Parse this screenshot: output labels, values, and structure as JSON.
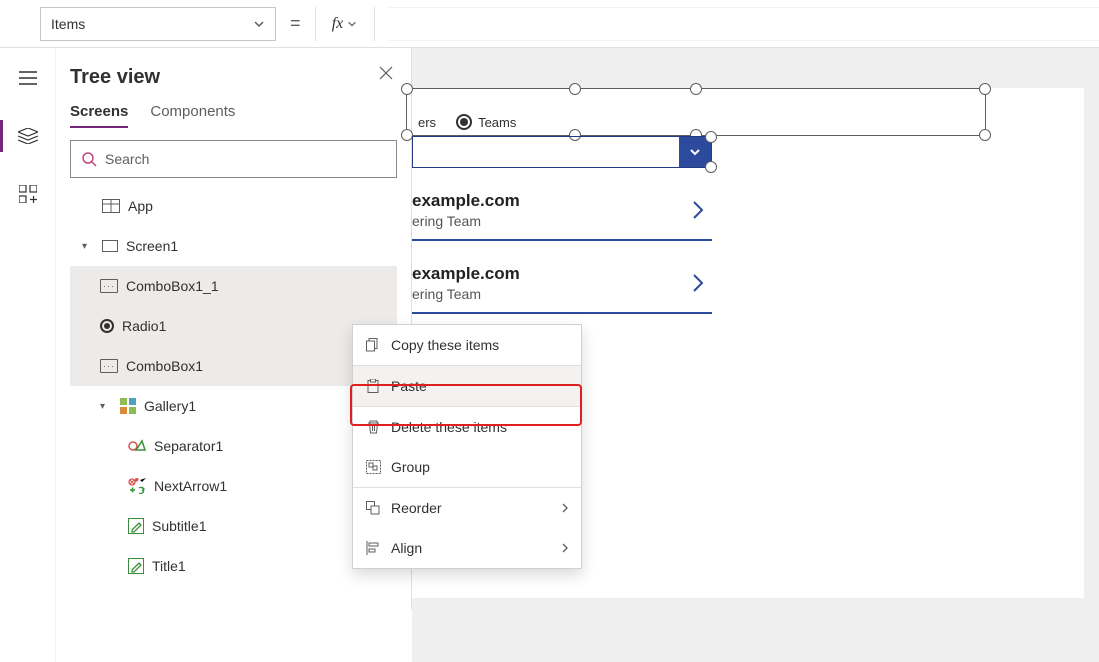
{
  "formula": {
    "property": "Items",
    "value": ""
  },
  "treeview": {
    "title": "Tree view",
    "tabs": {
      "screens": "Screens",
      "components": "Components"
    },
    "search_placeholder": "Search",
    "items": {
      "app": "App",
      "screen1": "Screen1",
      "combobox11": "ComboBox1_1",
      "radio1": "Radio1",
      "combobox1": "ComboBox1",
      "gallery1": "Gallery1",
      "separator1": "Separator1",
      "nextarrow1": "NextArrow1",
      "subtitle1": "Subtitle1",
      "title1": "Title1"
    }
  },
  "canvas": {
    "radio": {
      "opt1_partial": "ers",
      "opt2": "Teams"
    },
    "row1": {
      "title_partial": "example.com",
      "sub_partial": "ering Team"
    },
    "row2": {
      "title_partial": "example.com",
      "sub_partial": "ering Team"
    }
  },
  "ctx": {
    "copy": "Copy these items",
    "paste": "Paste",
    "delete": "Delete these items",
    "group": "Group",
    "reorder": "Reorder",
    "align": "Align"
  }
}
